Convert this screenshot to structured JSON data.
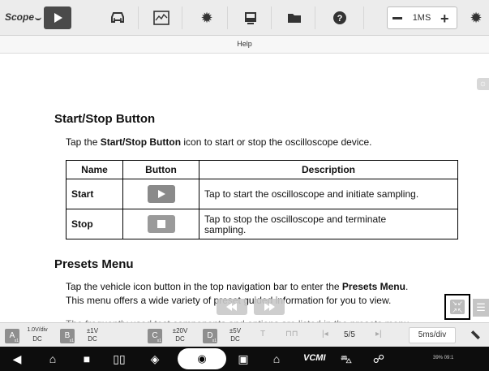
{
  "app": {
    "logo": "Scope"
  },
  "toolbar": {
    "icons": [
      "play-icon",
      "car-icon",
      "chart-icon",
      "gear-icon",
      "display-icon",
      "folder-icon",
      "help-icon",
      "settings-icon"
    ],
    "timebase_value": "1MS"
  },
  "helpbar": {
    "title": "Help"
  },
  "content": {
    "section1_title": "Start/Stop Button",
    "section1_para_pre": "Tap the ",
    "section1_para_bold": "Start/Stop Button",
    "section1_para_post": " icon to start or stop the oscilloscope device.",
    "table": {
      "headers": [
        "Name",
        "Button",
        "Description"
      ],
      "rows": [
        {
          "name": "Start",
          "button_icon": "start-icon",
          "description": "Tap to start the oscilloscope and initiate sampling."
        },
        {
          "name": "Stop",
          "button_icon": "stop-icon",
          "description_line1": "Tap to stop the oscilloscope and terminate",
          "description_line2": "sampling."
        }
      ]
    },
    "section2_title": "Presets Menu",
    "section2_para_line1_pre": "Tap the vehicle icon button in the top navigation bar to enter the ",
    "section2_para_line1_bold": "Presets Menu",
    "section2_para_line1_post": ".",
    "section2_para_line2": "This menu offers a wide variety of preset guided information for you to view.",
    "section2_para_line3": "The frequently used test components and options are listed in the presets menu."
  },
  "channels": [
    {
      "letter": "A",
      "sub": "x1",
      "line1": "1.0V/div",
      "line2": "DC"
    },
    {
      "letter": "B",
      "sub": "x1",
      "line1": "±1V",
      "line2": "DC"
    },
    {
      "letter": "C",
      "sub": "x1",
      "line1": "±20V",
      "line2": "DC"
    },
    {
      "letter": "D",
      "sub": "x1",
      "line1": "±5V",
      "line2": "DC"
    }
  ],
  "channelbar": {
    "page": "5/5",
    "time_div": "5ms/div"
  },
  "navbar": {
    "vcmi_label": "VCMI",
    "status_text": "39% 09:1"
  },
  "colors": {
    "toolbar_bg": "#ececec",
    "dark_button": "#4a4a4a",
    "navbar_bg": "#0d0d0d"
  }
}
